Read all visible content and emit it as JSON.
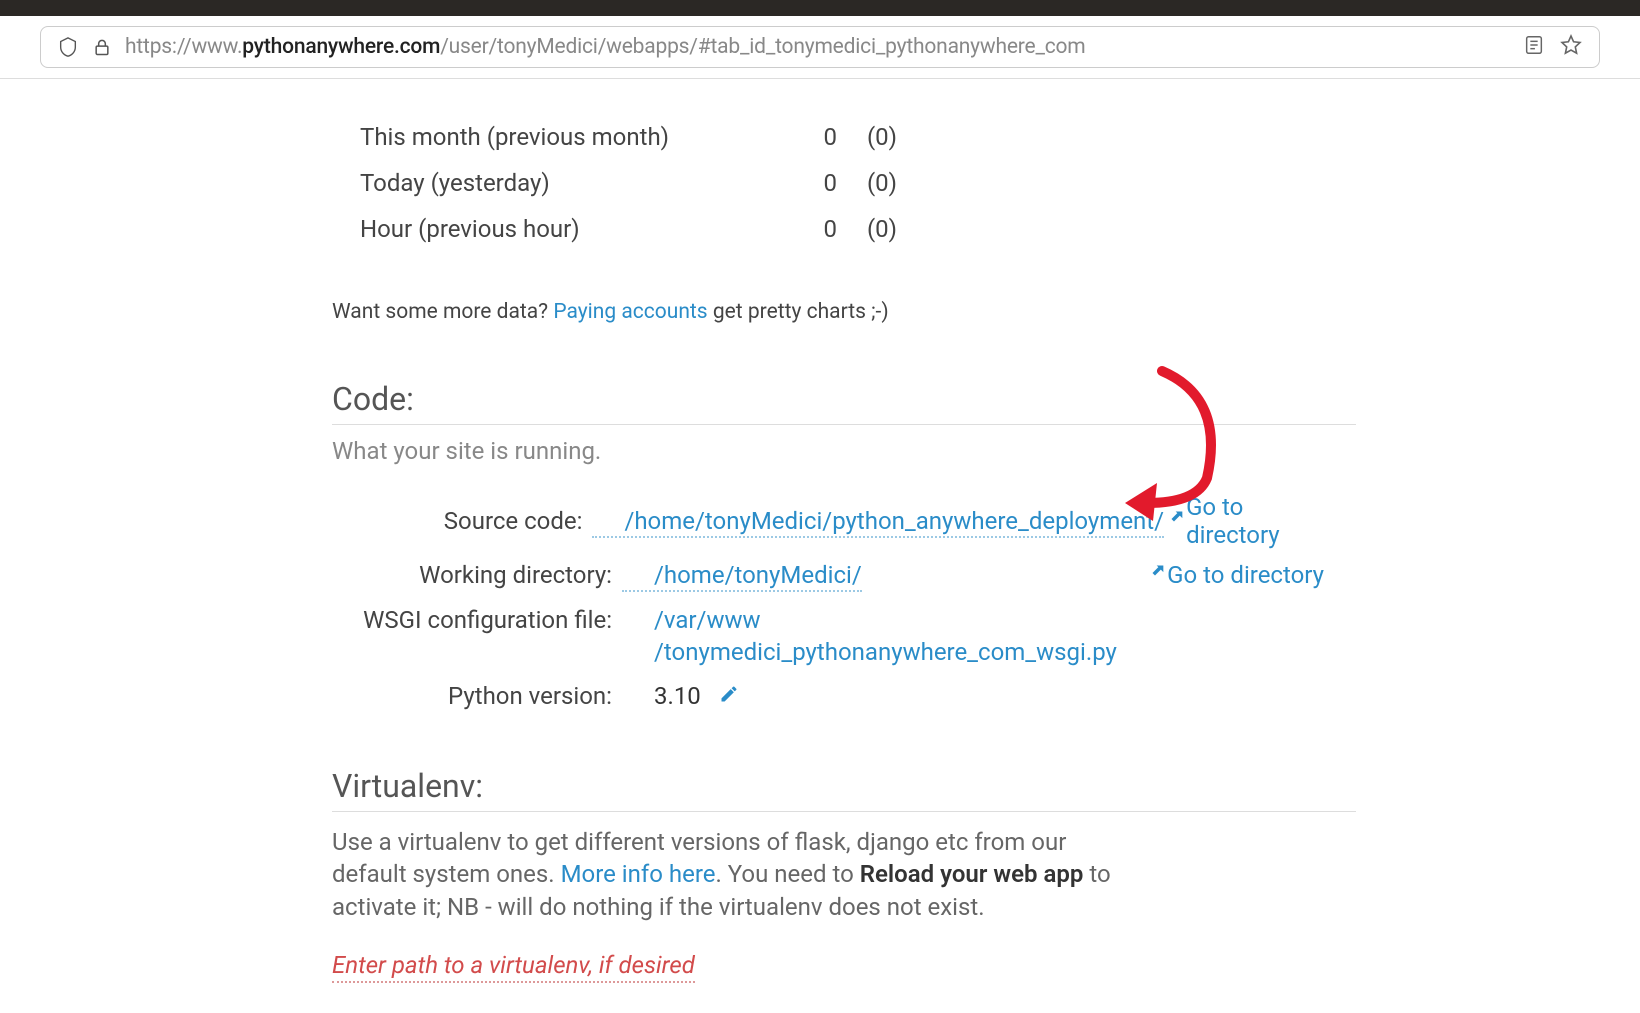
{
  "url": {
    "scheme": "https://",
    "domain_pre": "www.",
    "domain_bold": "pythonanywhere.com",
    "path": "/user/tonyMedici/webapps/#tab_id_tonymedici_pythonanywhere_com"
  },
  "stats": [
    {
      "label": "This month (previous month)",
      "val": "0",
      "prev": "(0)"
    },
    {
      "label": "Today (yesterday)",
      "val": "0",
      "prev": "(0)"
    },
    {
      "label": "Hour (previous hour)",
      "val": "0",
      "prev": "(0)"
    }
  ],
  "more_data": {
    "prefix": "Want some more data? ",
    "link": "Paying accounts",
    "suffix": " get pretty charts ;-)"
  },
  "code": {
    "heading": "Code:",
    "sub": "What your site is running.",
    "rows": {
      "source": {
        "label": "Source code:",
        "value": "/home/tonyMedici/python_anywhere_deployment/",
        "goto": "Go to directory"
      },
      "working": {
        "label": "Working directory:",
        "value": "/home/tonyMedici/",
        "goto": "Go to directory"
      },
      "wsgi": {
        "label": "WSGI configuration file:",
        "value": "/var/www\n/tonymedici_pythonanywhere_com_wsgi.py"
      },
      "python": {
        "label": "Python version:",
        "value": "3.10"
      }
    }
  },
  "virtualenv": {
    "heading": "Virtualenv:",
    "desc_pre": "Use a virtualenv to get different versions of flask, django etc from our default system ones. ",
    "desc_link": "More info here",
    "desc_mid": ". You need to ",
    "desc_bold": "Reload your web app",
    "desc_post": " to activate it; NB - will do nothing if the virtualenv does not exist.",
    "placeholder": "Enter path to a virtualenv, if desired"
  }
}
